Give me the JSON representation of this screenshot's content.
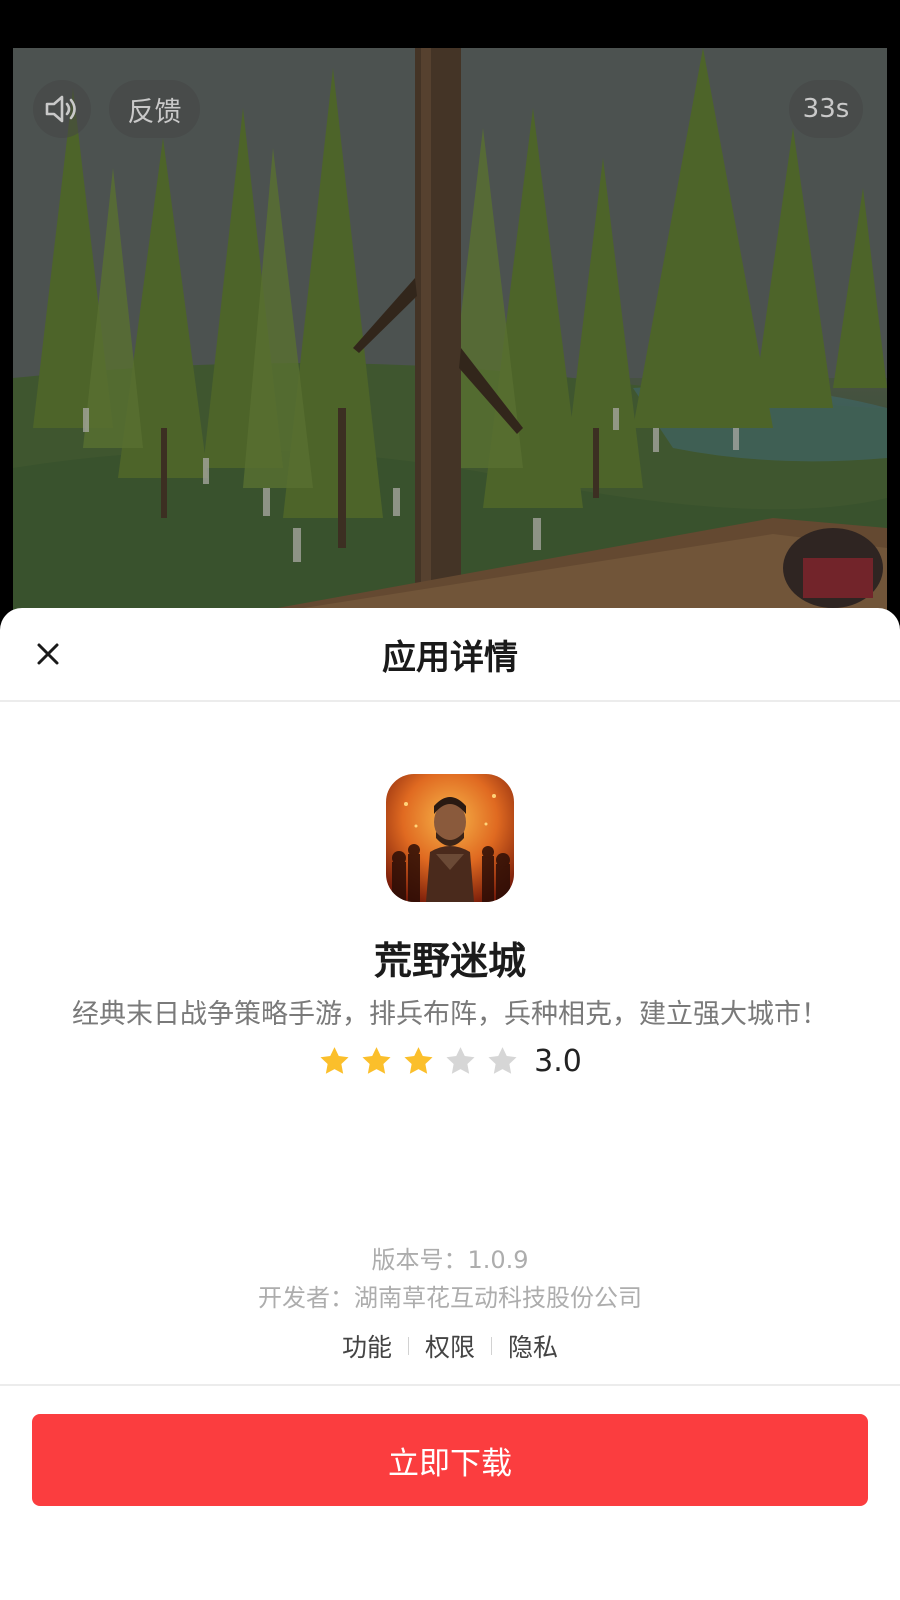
{
  "video": {
    "feedback_label": "反馈",
    "countdown": "33s",
    "icons": [
      "speaker-icon"
    ]
  },
  "sheet": {
    "title": "应用详情",
    "close_icon": "close-icon"
  },
  "app": {
    "name": "荒野迷城",
    "description": "经典末日战争策略手游，排兵布阵，兵种相克，建立强大城市！",
    "rating": 3.0,
    "rating_max": 5,
    "rating_text": "3.0",
    "version": "版本号：1.0.9",
    "developer": "开发者：湖南草花互动科技股份公司"
  },
  "links": {
    "features": "功能",
    "permissions": "权限",
    "privacy": "隐私"
  },
  "download_label": "立即下载",
  "colors": {
    "accent": "#fb3d3f",
    "star_filled": "#fbbf2b",
    "star_empty": "#d6d6d6"
  }
}
